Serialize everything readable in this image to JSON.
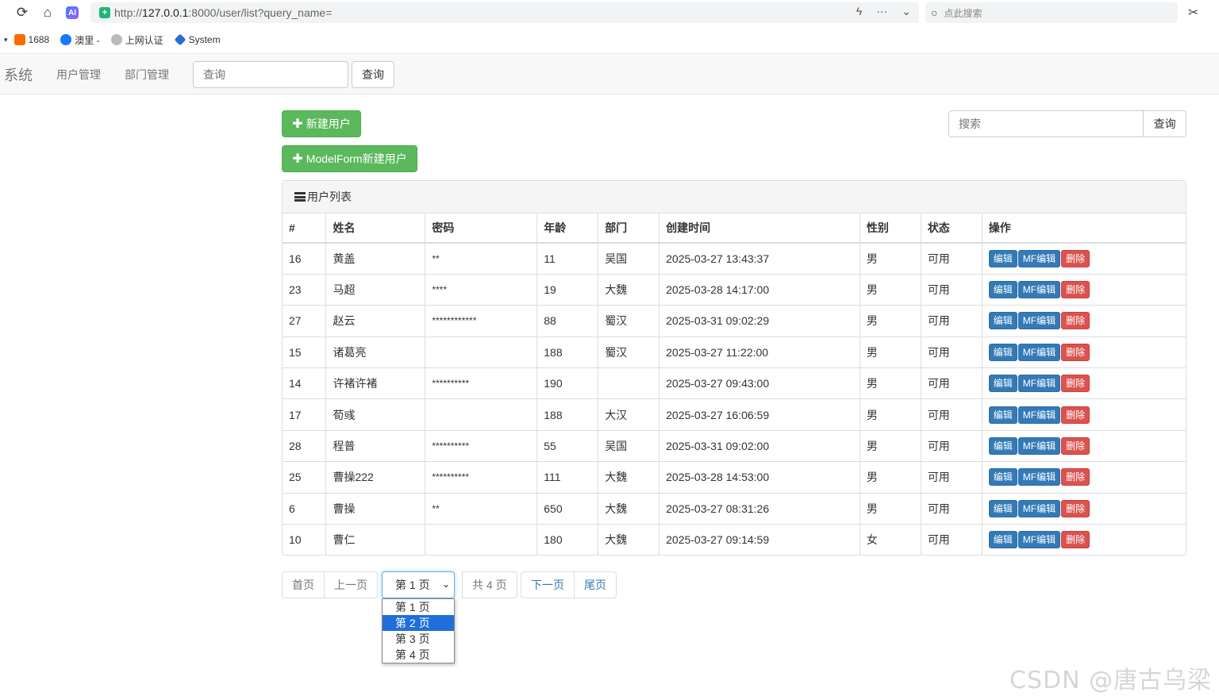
{
  "browser": {
    "url_proto": "http://",
    "url_host": "127.0.0.1",
    "url_rest": ":8000/user/list?query_name=",
    "search_placeholder": "点此搜索",
    "bookmarks": [
      {
        "label": "1688",
        "color": "#ff6a00"
      },
      {
        "label": "澳里 -",
        "color": "#1677ff"
      },
      {
        "label": "上网认证",
        "color": "#999999"
      },
      {
        "label": "System",
        "color": "#2b6bd8"
      }
    ]
  },
  "navbar": {
    "brand": "系统",
    "links": [
      "用户管理",
      "部门管理"
    ],
    "search_placeholder": "查询",
    "search_button": "查询"
  },
  "actions": {
    "new_user": "新建用户",
    "new_user_modelform": "ModelForm新建用户",
    "search_placeholder": "搜索",
    "search_button": "查询"
  },
  "panel": {
    "title": "用户列表",
    "columns": [
      "#",
      "姓名",
      "密码",
      "年龄",
      "部门",
      "创建时间",
      "性别",
      "状态",
      "操作"
    ],
    "row_buttons": {
      "edit": "编辑",
      "mf_edit": "MF编辑",
      "delete": "删除"
    },
    "rows": [
      {
        "id": "16",
        "name": "黄盖",
        "password": "**",
        "age": "11",
        "dept": "吴国",
        "created": "2025-03-27 13:43:37",
        "gender": "男",
        "status": "可用"
      },
      {
        "id": "23",
        "name": "马超",
        "password": "****",
        "age": "19",
        "dept": "大魏",
        "created": "2025-03-28 14:17:00",
        "gender": "男",
        "status": "可用"
      },
      {
        "id": "27",
        "name": "赵云",
        "password": "************",
        "age": "88",
        "dept": "蜀汉",
        "created": "2025-03-31 09:02:29",
        "gender": "男",
        "status": "可用"
      },
      {
        "id": "15",
        "name": "诸葛亮",
        "password": "",
        "age": "188",
        "dept": "蜀汉",
        "created": "2025-03-27 11:22:00",
        "gender": "男",
        "status": "可用"
      },
      {
        "id": "14",
        "name": "许褚许褚",
        "password": "**********",
        "age": "190",
        "dept": "",
        "created": "2025-03-27 09:43:00",
        "gender": "男",
        "status": "可用"
      },
      {
        "id": "17",
        "name": "荀彧",
        "password": "",
        "age": "188",
        "dept": "大汉",
        "created": "2025-03-27 16:06:59",
        "gender": "男",
        "status": "可用"
      },
      {
        "id": "28",
        "name": "程普",
        "password": "**********",
        "age": "55",
        "dept": "吴国",
        "created": "2025-03-31 09:02:00",
        "gender": "男",
        "status": "可用"
      },
      {
        "id": "25",
        "name": "曹操222",
        "password": "**********",
        "age": "111",
        "dept": "大魏",
        "created": "2025-03-28 14:53:00",
        "gender": "男",
        "status": "可用"
      },
      {
        "id": "6",
        "name": "曹操",
        "password": "**",
        "age": "650",
        "dept": "大魏",
        "created": "2025-03-27 08:31:26",
        "gender": "男",
        "status": "可用"
      },
      {
        "id": "10",
        "name": "曹仁",
        "password": "",
        "age": "180",
        "dept": "大魏",
        "created": "2025-03-27 09:14:59",
        "gender": "女",
        "status": "可用"
      }
    ]
  },
  "pagination": {
    "first": "首页",
    "prev": "上一页",
    "current": "第 1 页",
    "total": "共 4 页",
    "next": "下一页",
    "last": "尾页",
    "options": [
      "第 1 页",
      "第 2 页",
      "第 3 页",
      "第 4 页"
    ],
    "highlighted_option": 1
  },
  "watermark": "CSDN @唐古乌梁海"
}
